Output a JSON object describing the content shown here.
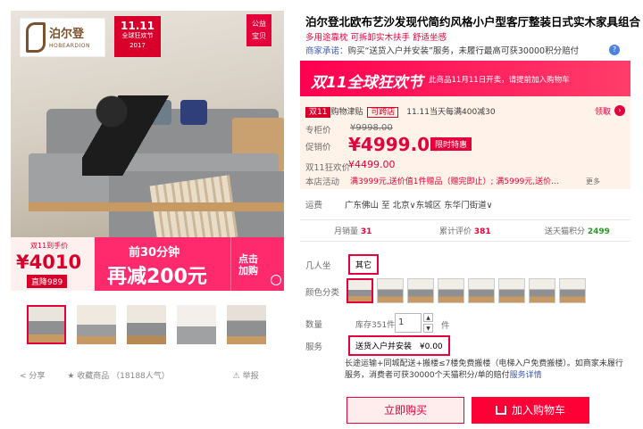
{
  "brand": {
    "name_cn": "泊尔登",
    "name_en": "HOBEARDION",
    "mark": "®"
  },
  "badges": {
    "festival_line1": "11.11",
    "festival_line2": "全球狂欢节",
    "festival_year": "2017",
    "welfare": "公益\n宝贝"
  },
  "promo": {
    "double11_price_label": "双11到手价",
    "double11_price": "¥4010",
    "direct_discount": "直降989",
    "first_30min": "前30分钟",
    "minus_200": "再减200元",
    "click_buy": "点击\n加购"
  },
  "bottom": {
    "share": "分享",
    "favorite": "收藏商品",
    "popularity": "（18188人气）",
    "report": "举报"
  },
  "product": {
    "title": "泊尔登北欧布艺沙发现代简约风格小户型客厅整装日式实木家具组合",
    "subtitle": "多用途靠枕 可拆卸实木扶手 舒适坐感",
    "promise_label": "商家承诺：",
    "promise_text": "购买“送货入户并安装”服务，未履行最高可获30000积分赔付",
    "help_icon": "?"
  },
  "banner": {
    "title": "双11全球狂欢节",
    "notice": "此商品11月11日开卖，请提前加入购物车"
  },
  "jintie": {
    "tag1": "双11",
    "tag2": "购物津贴",
    "tag3": "可跨店",
    "text": "11.11当天每满400减30",
    "claim": "领取"
  },
  "prices": {
    "original_label": "专柜价",
    "original": "¥9998.00",
    "sale_label": "促销价",
    "sale": "¥4999.00",
    "limited_tag": "限时特惠",
    "festival_label": "双11狂欢价",
    "festival": "¥4499.00",
    "activity_label": "本店活动",
    "activity": "满3999元,送价值1件赠品（赠完即止）; 满5999元,送价...",
    "more": "更多"
  },
  "shipping": {
    "label": "运费",
    "from": "广东佛山",
    "to_label": "至",
    "to": "北京∨东城区 东华门街道∨"
  },
  "stats": {
    "monthly_label": "月销量",
    "monthly": "31",
    "reviews_label": "累计评价",
    "reviews": "381",
    "points_label": "送天猫积分",
    "points": "2499"
  },
  "sku": {
    "seat_label": "几人坐",
    "seat_option": "其它",
    "color_label": "颜色分类",
    "swatch_count": 8,
    "qty_label": "数量",
    "stock": "库存351件",
    "qty_value": "1",
    "qty_unit": "件",
    "service_label": "服务",
    "service_option": "送货入户并安装",
    "service_price": "¥0.00",
    "service_desc": "长途运输+同城配送+搬楼≤7楼免费搬楼（电梯入户免费搬楼）。如商家未履行服务，消费者可获30000个天猫积分/单的赔付",
    "service_link": "服务详情"
  },
  "actions": {
    "buy_now": "立即购买",
    "add_cart": "加入购物车"
  },
  "colors": {
    "accent": "#e4003a",
    "festival_red": "#ff0050",
    "link_blue": "#3c5ab4"
  }
}
